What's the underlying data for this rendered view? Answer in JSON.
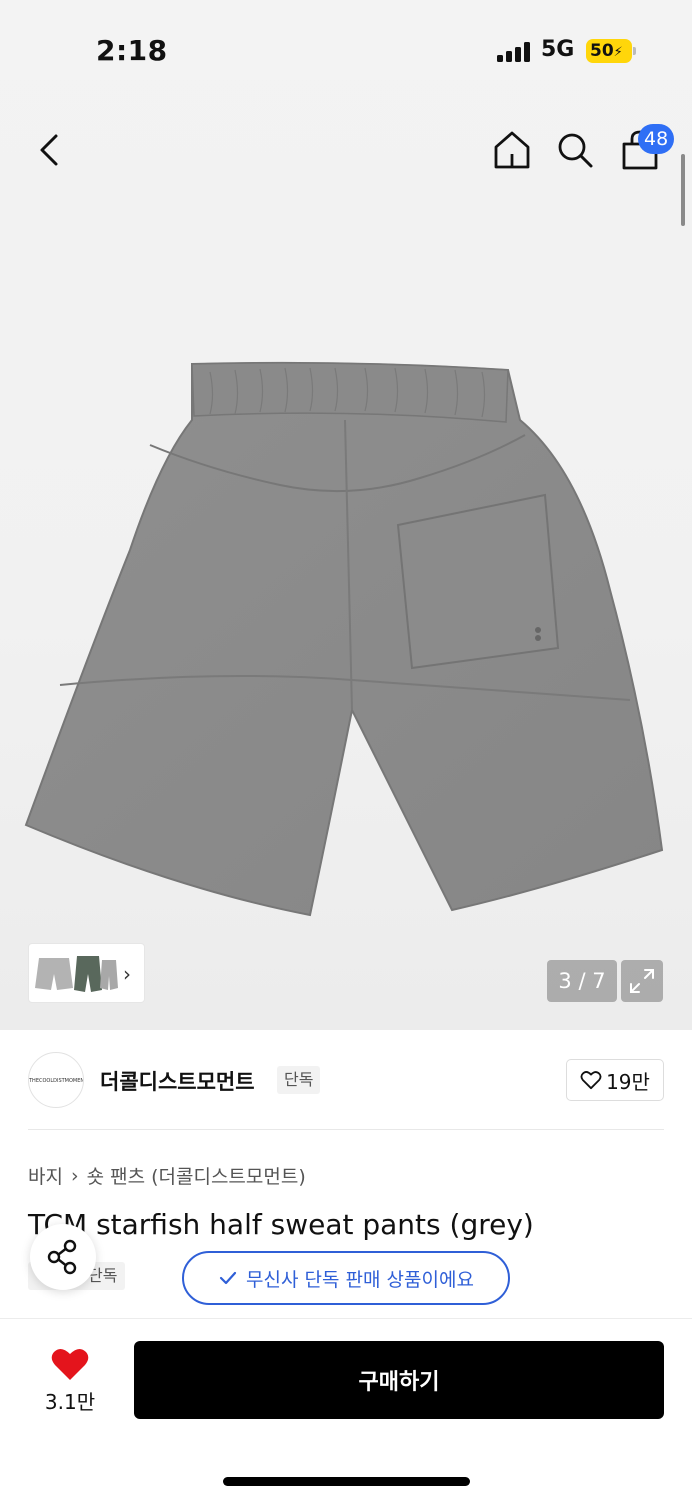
{
  "status_bar": {
    "time": "2:18",
    "network": "5G",
    "battery": "50"
  },
  "header": {
    "cart_count": "48"
  },
  "gallery": {
    "counter": "3 / 7"
  },
  "brand": {
    "logo_text": "THECOOLDISTMOMENT",
    "name": "더콜디스트모먼트",
    "exclusive_label": "단독",
    "like_count": "19만"
  },
  "product": {
    "breadcrumb_category": "바지",
    "breadcrumb_sub": "숏 팬츠 (더콜디스트모먼트)",
    "title": "TCM starfish half sweat pants (grey)",
    "exclusive_tag": "단독",
    "musinsa_exclusive": "무신사 단독 판매 상품이에요"
  },
  "bottom_bar": {
    "wish_count": "3.1만",
    "buy_label": "구매하기"
  },
  "colors": {
    "accent_blue": "#2f5fd7",
    "badge_blue": "#2f6ff5",
    "heart_red": "#e4141c",
    "fabric_grey": "#8c8c8c"
  }
}
